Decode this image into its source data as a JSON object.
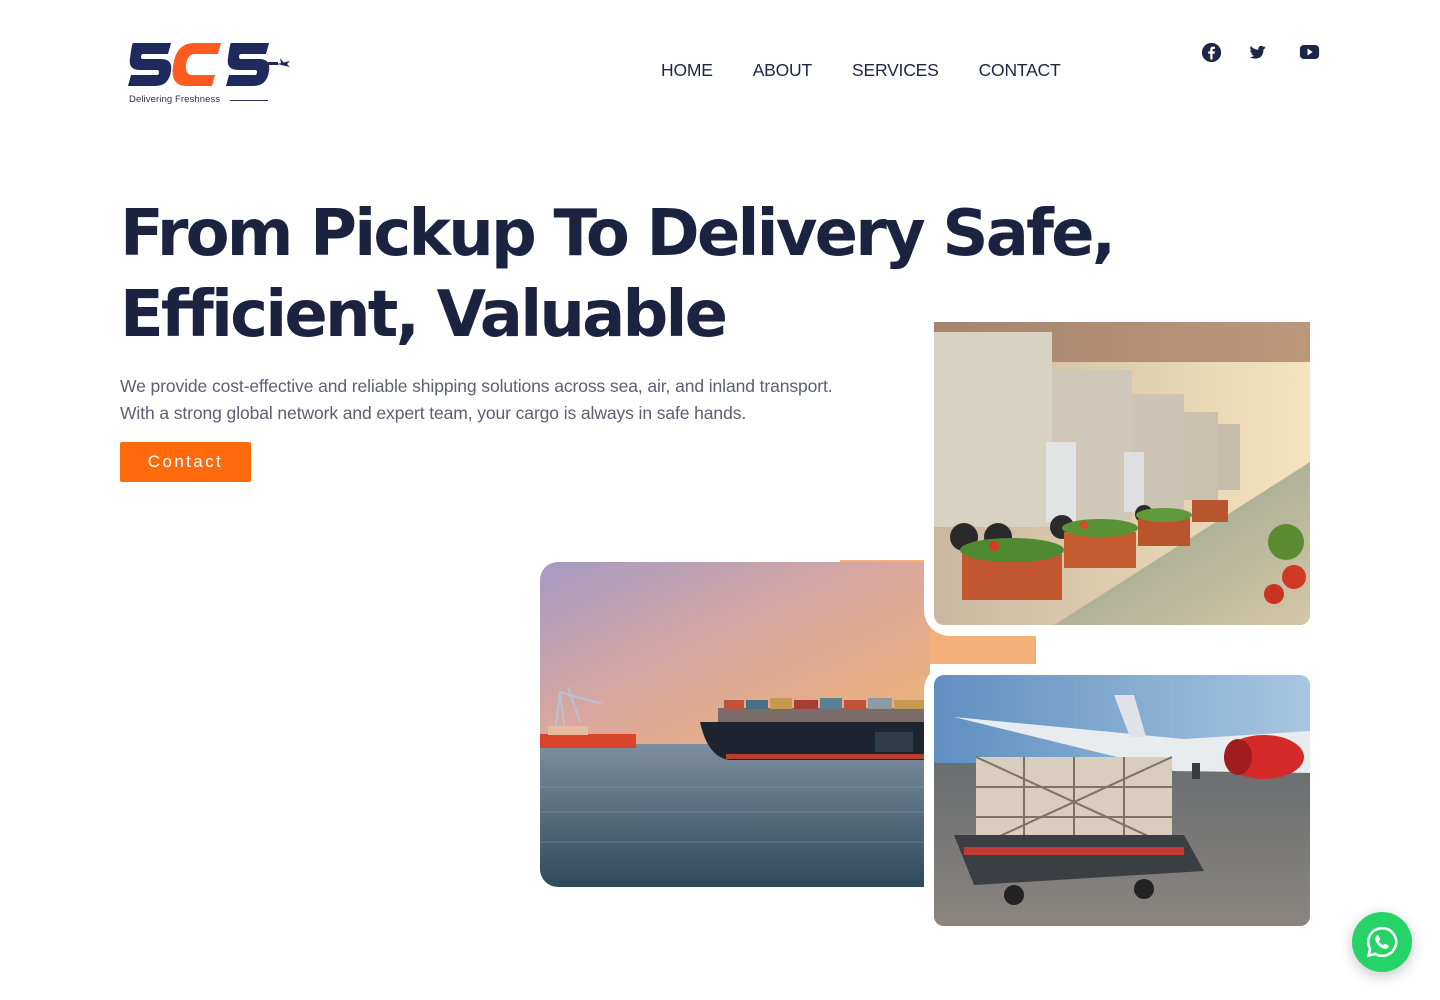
{
  "brand": {
    "logo_text": "SCS",
    "tagline": "Delivering Freshness",
    "navy": "#1e2a5c",
    "orange": "#ff6a0c"
  },
  "nav": {
    "items": [
      {
        "label": "HOME"
      },
      {
        "label": "ABOUT"
      },
      {
        "label": "SERVICES"
      },
      {
        "label": "CONTACT"
      }
    ]
  },
  "social": {
    "icons": [
      "facebook-icon",
      "twitter-icon",
      "youtube-icon"
    ]
  },
  "hero": {
    "title_line1": "From Pickup To Delivery Safe,",
    "title_line2": "Efficient, Valuable",
    "description_line1": "We provide cost-effective and reliable shipping solutions across sea, air, and inland transport.",
    "description_line2": "With a strong global network and expert team, your cargo is always in safe hands.",
    "cta_label": "Contact",
    "cta_color": "#ff6a0c"
  },
  "images": {
    "ship_photo": "container-ship-at-sea",
    "trucks_photo": "refrigerated-trucks-with-produce",
    "plane_photo": "air-cargo-pallet-by-airplane"
  },
  "floating": {
    "whatsapp_icon": "whatsapp-icon",
    "whatsapp_color": "#26d366"
  }
}
